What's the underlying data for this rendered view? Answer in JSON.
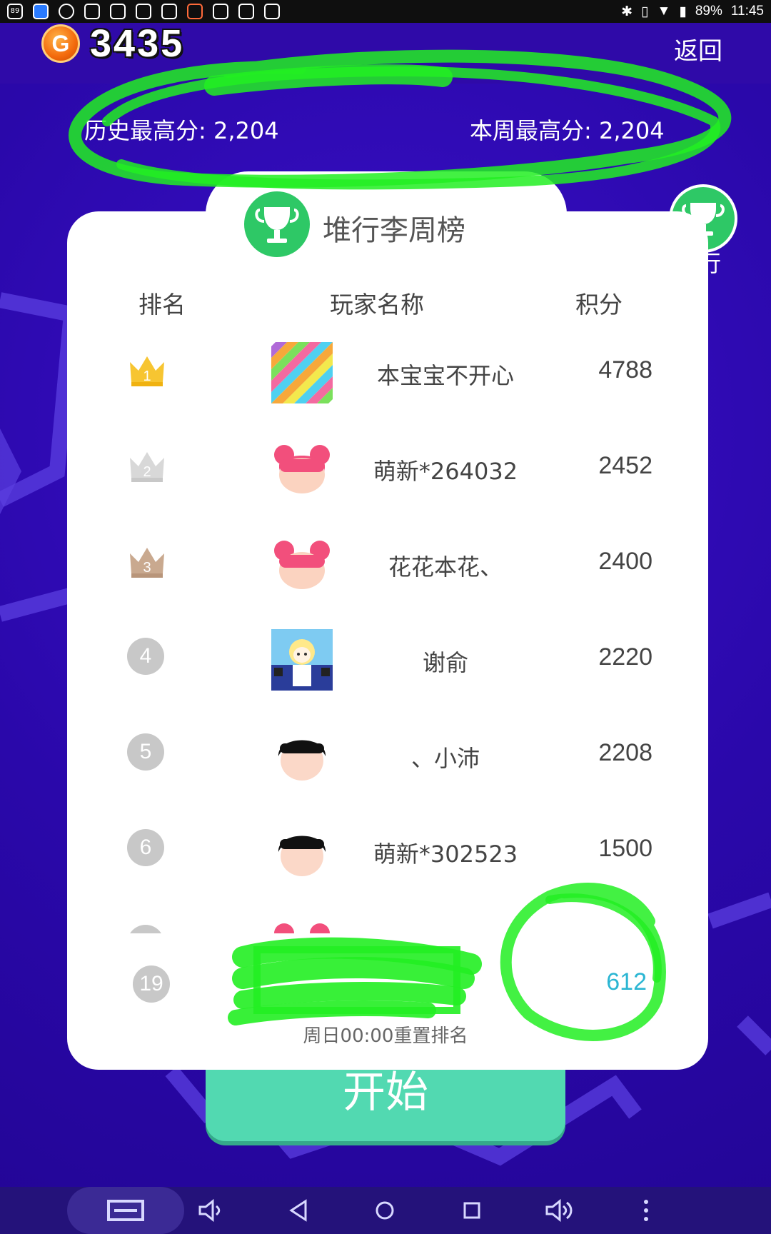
{
  "status_bar": {
    "battery": "89%",
    "time": "11:45",
    "left_icons": [
      "notification-icon",
      "photos-app-icon",
      "search-app-icon",
      "file-app-icon",
      "bili-icon",
      "baidu-icon",
      "baidu-icon",
      "cleaner-icon",
      "bili-icon",
      "sogou-icon",
      "bili-icon"
    ],
    "left_icon_text": "89"
  },
  "header": {
    "coin_symbol": "G",
    "coin_count": "3435",
    "back_label": "返回"
  },
  "scores": {
    "history_best": "历史最高分: 2,204",
    "week_best": "本周最高分: 2,204"
  },
  "side_button": {
    "label": "行"
  },
  "leaderboard": {
    "title": "堆行李周榜",
    "columns": {
      "rank": "排名",
      "name": "玩家名称",
      "score": "积分"
    },
    "rows": [
      {
        "rank": "1",
        "name": "本宝宝不开心",
        "score": "4788",
        "avatar": "rainbow-stripes"
      },
      {
        "rank": "2",
        "name": "萌新*264032",
        "score": "2452",
        "avatar": "pink-hair"
      },
      {
        "rank": "3",
        "name": "花花本花、",
        "score": "2400",
        "avatar": "pink-hair"
      },
      {
        "rank": "4",
        "name": "谢俞",
        "score": "2220",
        "avatar": "anime-girl"
      },
      {
        "rank": "5",
        "name": "、小沛",
        "score": "2208",
        "avatar": "black-hair"
      },
      {
        "rank": "6",
        "name": "萌新*302523",
        "score": "1500",
        "avatar": "black-hair"
      }
    ],
    "my_entry": {
      "rank": "19",
      "score": "612"
    },
    "reset_note": "周日00:00重置排名"
  },
  "start_button": {
    "label": "开始"
  },
  "colors": {
    "background": "#2a08a8",
    "accent_green": "#2ec866",
    "start_button": "#52d9b1",
    "my_score": "#2bb6d3",
    "annotation_green": "#22ee22"
  }
}
